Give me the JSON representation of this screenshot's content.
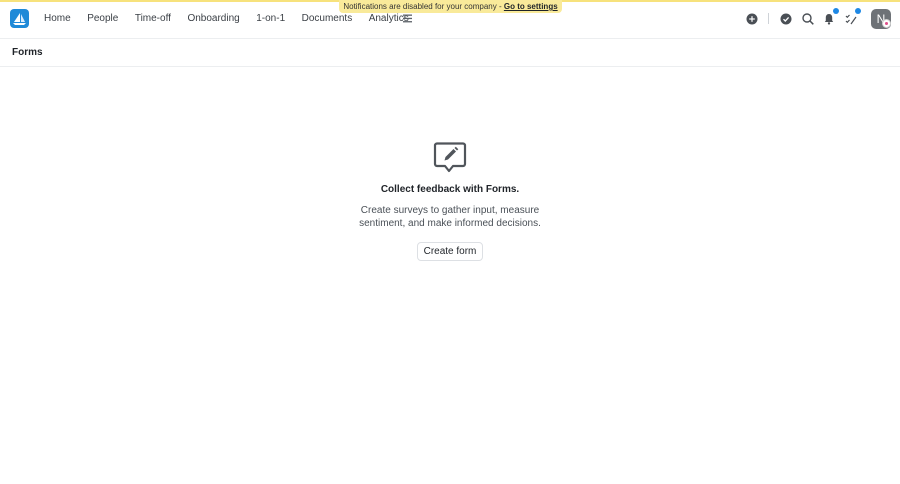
{
  "banner": {
    "text": "Notifications are disabled for your company - ",
    "link": "Go to settings"
  },
  "colors": {
    "brand": "#1f8ad8",
    "banner": "#f9ea9a",
    "notification_dot": "#1e88e5"
  },
  "nav": {
    "items": [
      {
        "label": "Home"
      },
      {
        "label": "People"
      },
      {
        "label": "Time-off"
      },
      {
        "label": "Onboarding"
      },
      {
        "label": "1-on-1"
      },
      {
        "label": "Documents"
      },
      {
        "label": "Analytics"
      }
    ],
    "icons": [
      "menu-icon",
      "add-circle-icon",
      "check-circle-icon",
      "search-icon",
      "bell-icon",
      "tasks-icon"
    ]
  },
  "user": {
    "initial": "N"
  },
  "page": {
    "title": "Forms"
  },
  "empty_state": {
    "icon": "form-chat-icon",
    "title": "Collect feedback with Forms.",
    "description": "Create surveys to gather input, measure sentiment, and make informed decisions.",
    "button_label": "Create form"
  }
}
